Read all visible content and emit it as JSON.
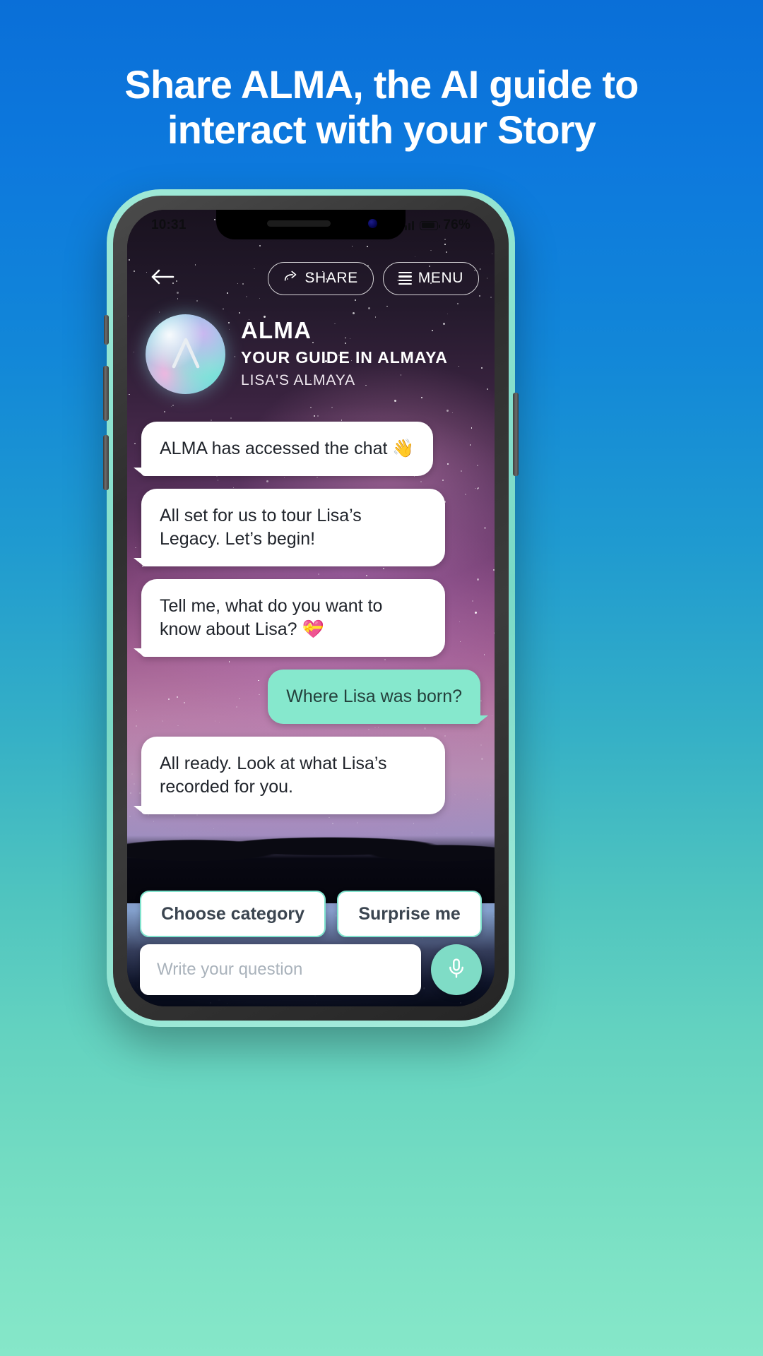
{
  "headline": {
    "line1": "Share ALMA, the AI guide to",
    "line2": "interact with your Story"
  },
  "phone": {
    "status_bar": {
      "time": "10:31",
      "battery_percent": "76%",
      "signal_icon": "signal-bars-icon",
      "wifi_icon": "wifi-icon",
      "battery_icon": "battery-icon"
    },
    "top_nav": {
      "back_icon": "back-arrow-icon",
      "share_label": "SHARE",
      "share_icon": "share-arrow-icon",
      "menu_label": "MENU",
      "menu_icon": "hamburger-menu-icon"
    },
    "profile": {
      "avatar_icon": "alma-logo-icon",
      "name": "ALMA",
      "subtitle": "YOUR GUIDE IN ALMAYA",
      "owner": "LISA'S ALMAYA"
    },
    "chat": [
      {
        "from": "alma",
        "text": "ALMA has accessed the chat 👋"
      },
      {
        "from": "alma",
        "text": "All set for us to tour Lisa’s Legacy. Let’s begin!"
      },
      {
        "from": "alma",
        "text": "Tell me, what do you want to know about Lisa? 💝"
      },
      {
        "from": "user",
        "text": "Where Lisa was born?"
      },
      {
        "from": "alma",
        "text": "All ready. Look at what Lisa’s recorded for you."
      }
    ],
    "quick_actions": [
      {
        "label": "Choose category"
      },
      {
        "label": "Surprise me"
      }
    ],
    "composer": {
      "placeholder": "Write your question",
      "mic_icon": "microphone-icon"
    }
  },
  "colors": {
    "brand_blue": "#0d79dd",
    "brand_teal": "#7fe3c6",
    "user_bubble": "#86e8cd",
    "alma_bubble": "#ffffff"
  }
}
